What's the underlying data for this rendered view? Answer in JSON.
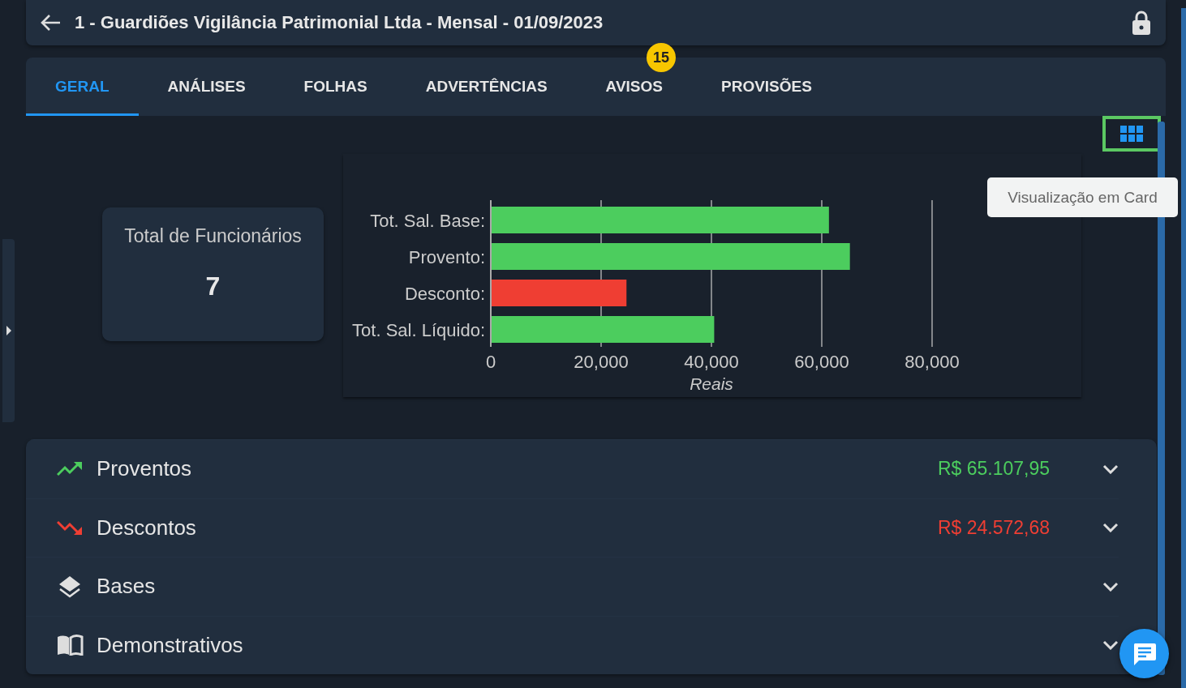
{
  "header": {
    "title": "1 - Guardiões Vigilância Patrimonial Ltda - Mensal - 01/09/2023"
  },
  "tabs": [
    {
      "label": "GERAL",
      "selected": true
    },
    {
      "label": "ANÁLISES",
      "selected": false
    },
    {
      "label": "FOLHAS",
      "selected": false
    },
    {
      "label": "ADVERTÊNCIAS",
      "selected": false
    },
    {
      "label": "AVISOS",
      "selected": false,
      "badge": "15"
    },
    {
      "label": "PROVISÕES",
      "selected": false
    }
  ],
  "view_toggle": {
    "tooltip": "Visualização em Card"
  },
  "stat_card": {
    "label": "Total de Funcionários",
    "value": "7"
  },
  "chart": {
    "category_separator": ":",
    "chart_data": {
      "type": "bar",
      "orientation": "horizontal",
      "stacked": true,
      "xlabel": "Reais",
      "grid": true,
      "categories": [
        "Tot. Sal. Base",
        "Provento",
        "Desconto",
        "Tot. Sal. Líquido"
      ],
      "series": [
        {
          "color": "#4ccd5e",
          "values": [
            61300,
            65100,
            null,
            40500
          ]
        },
        {
          "color": "#ef3e33",
          "values": [
            null,
            null,
            24600,
            null
          ]
        }
      ],
      "xlim": [
        0,
        80000
      ],
      "xticks": [
        {
          "value": 0,
          "label": "0"
        },
        {
          "value": 20000,
          "label": "20,000"
        },
        {
          "value": 40000,
          "label": "40,000"
        },
        {
          "value": 60000,
          "label": "60,000"
        },
        {
          "value": 80000,
          "label": "80,000"
        }
      ]
    }
  },
  "sections": [
    {
      "kind": "up",
      "title": "Proventos",
      "amount": "R$ 65.107,95",
      "color": "#4ccd5e"
    },
    {
      "kind": "down",
      "title": "Descontos",
      "amount": "R$ 24.572,68",
      "color": "#ef3e33"
    },
    {
      "kind": "layers",
      "title": "Bases"
    },
    {
      "kind": "book",
      "title": "Demonstrativos"
    }
  ]
}
